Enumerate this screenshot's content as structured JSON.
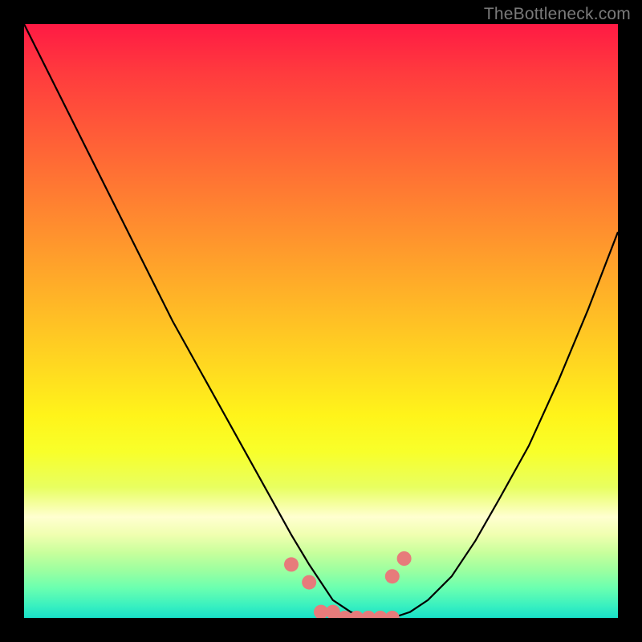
{
  "watermark": "TheBottleneck.com",
  "chart_data": {
    "type": "line",
    "title": "",
    "xlabel": "",
    "ylabel": "",
    "xlim": [
      0,
      100
    ],
    "ylim": [
      0,
      100
    ],
    "x": [
      0,
      5,
      10,
      15,
      20,
      25,
      30,
      35,
      40,
      45,
      48,
      50,
      52,
      55,
      58,
      60,
      62,
      65,
      68,
      72,
      76,
      80,
      85,
      90,
      95,
      100
    ],
    "values": [
      100,
      90,
      80,
      70,
      60,
      50,
      41,
      32,
      23,
      14,
      9,
      6,
      3,
      1,
      0,
      0,
      0,
      1,
      3,
      7,
      13,
      20,
      29,
      40,
      52,
      65
    ],
    "markers": {
      "x": [
        45,
        48,
        50,
        52,
        54,
        56,
        58,
        60,
        62,
        62,
        64
      ],
      "y": [
        9,
        6,
        1,
        1,
        0,
        0,
        0,
        0,
        0,
        7,
        10
      ]
    },
    "colors": {
      "curve": "#000000",
      "marker": "#e77b7b",
      "gradient_top": "#ff1a44",
      "gradient_bottom": "#18e0c8"
    }
  }
}
